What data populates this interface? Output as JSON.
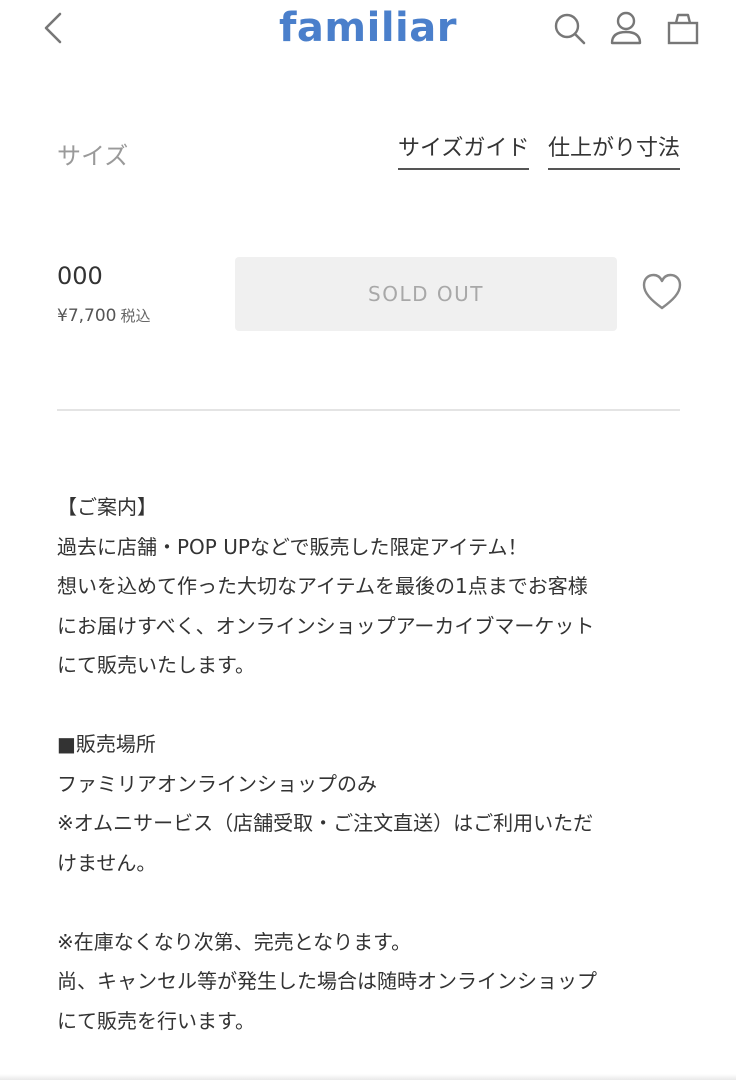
{
  "header": {
    "logo": "familiar",
    "icons": [
      "chevron-left-icon",
      "search-icon",
      "user-icon",
      "bag-icon"
    ],
    "brand_color": "#4a7fcb"
  },
  "size_section": {
    "label": "サイズ",
    "size_guide_link": "サイズガイド",
    "finished_dimensions_link": "仕上がり寸法"
  },
  "item": {
    "name": "000",
    "price": "¥7,700",
    "tax_label": "税込",
    "button_label": "SOLD OUT"
  },
  "description": [
    "【ご案内】",
    "過去に店舗・POP UPなどで販売した限定アイテム！",
    "想いを込めて作った大切なアイテムを最後の1点までお客様",
    "にお届けすべく、オンラインショップアーカイブマーケット",
    "にて販売いたします。",
    "",
    "■販売場所",
    "ファミリアオンラインショップのみ",
    "※オムニサービス（店舗受取・ご注文直送）はご利用いただ",
    "けません。",
    "",
    "※在庫なくなり次第、完売となります。",
    "尚、キャンセル等が発生した場合は随時オンラインショップ",
    "にて販売を行います。"
  ]
}
